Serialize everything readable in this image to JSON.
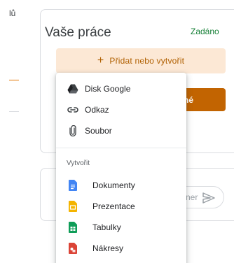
{
  "left_fragment": "lů",
  "work_card": {
    "title": "Vaše práce",
    "status": "Zadáno",
    "add_button": {
      "plus": "+",
      "label": "Přidat nebo vytvořit"
    },
    "submit_fragment": "né"
  },
  "comment_card": {
    "input_fragment": "ner"
  },
  "menu": {
    "attach_items": [
      {
        "label": "Disk Google",
        "icon": "google-drive-icon"
      },
      {
        "label": "Odkaz",
        "icon": "link-icon"
      },
      {
        "label": "Soubor",
        "icon": "paperclip-icon"
      }
    ],
    "create_section": "Vytvořit",
    "create_items": [
      {
        "label": "Dokumenty",
        "icon": "docs-icon",
        "color": "#4285f4"
      },
      {
        "label": "Prezentace",
        "icon": "slides-icon",
        "color": "#f4b400"
      },
      {
        "label": "Tabulky",
        "icon": "sheets-icon",
        "color": "#0f9d58"
      },
      {
        "label": "Nákresy",
        "icon": "drawings-icon",
        "color": "#db4437"
      }
    ]
  },
  "colors": {
    "accent": "#c26401",
    "accent_light": "#fce8d5",
    "status_green": "#188038"
  }
}
